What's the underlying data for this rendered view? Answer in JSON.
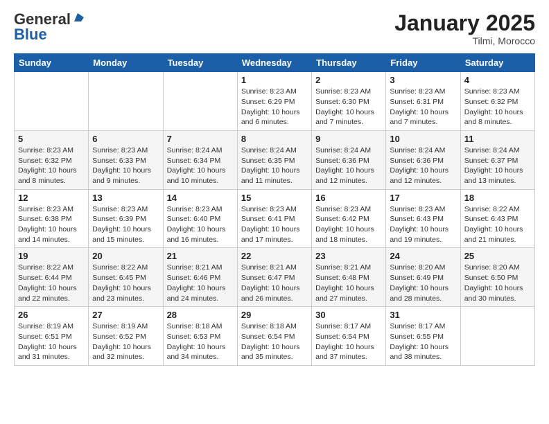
{
  "logo": {
    "general": "General",
    "blue": "Blue"
  },
  "header": {
    "month": "January 2025",
    "location": "Tilmi, Morocco"
  },
  "weekdays": [
    "Sunday",
    "Monday",
    "Tuesday",
    "Wednesday",
    "Thursday",
    "Friday",
    "Saturday"
  ],
  "weeks": [
    [
      {
        "day": "",
        "info": ""
      },
      {
        "day": "",
        "info": ""
      },
      {
        "day": "",
        "info": ""
      },
      {
        "day": "1",
        "info": "Sunrise: 8:23 AM\nSunset: 6:29 PM\nDaylight: 10 hours\nand 6 minutes."
      },
      {
        "day": "2",
        "info": "Sunrise: 8:23 AM\nSunset: 6:30 PM\nDaylight: 10 hours\nand 7 minutes."
      },
      {
        "day": "3",
        "info": "Sunrise: 8:23 AM\nSunset: 6:31 PM\nDaylight: 10 hours\nand 7 minutes."
      },
      {
        "day": "4",
        "info": "Sunrise: 8:23 AM\nSunset: 6:32 PM\nDaylight: 10 hours\nand 8 minutes."
      }
    ],
    [
      {
        "day": "5",
        "info": "Sunrise: 8:23 AM\nSunset: 6:32 PM\nDaylight: 10 hours\nand 8 minutes."
      },
      {
        "day": "6",
        "info": "Sunrise: 8:23 AM\nSunset: 6:33 PM\nDaylight: 10 hours\nand 9 minutes."
      },
      {
        "day": "7",
        "info": "Sunrise: 8:24 AM\nSunset: 6:34 PM\nDaylight: 10 hours\nand 10 minutes."
      },
      {
        "day": "8",
        "info": "Sunrise: 8:24 AM\nSunset: 6:35 PM\nDaylight: 10 hours\nand 11 minutes."
      },
      {
        "day": "9",
        "info": "Sunrise: 8:24 AM\nSunset: 6:36 PM\nDaylight: 10 hours\nand 12 minutes."
      },
      {
        "day": "10",
        "info": "Sunrise: 8:24 AM\nSunset: 6:36 PM\nDaylight: 10 hours\nand 12 minutes."
      },
      {
        "day": "11",
        "info": "Sunrise: 8:24 AM\nSunset: 6:37 PM\nDaylight: 10 hours\nand 13 minutes."
      }
    ],
    [
      {
        "day": "12",
        "info": "Sunrise: 8:23 AM\nSunset: 6:38 PM\nDaylight: 10 hours\nand 14 minutes."
      },
      {
        "day": "13",
        "info": "Sunrise: 8:23 AM\nSunset: 6:39 PM\nDaylight: 10 hours\nand 15 minutes."
      },
      {
        "day": "14",
        "info": "Sunrise: 8:23 AM\nSunset: 6:40 PM\nDaylight: 10 hours\nand 16 minutes."
      },
      {
        "day": "15",
        "info": "Sunrise: 8:23 AM\nSunset: 6:41 PM\nDaylight: 10 hours\nand 17 minutes."
      },
      {
        "day": "16",
        "info": "Sunrise: 8:23 AM\nSunset: 6:42 PM\nDaylight: 10 hours\nand 18 minutes."
      },
      {
        "day": "17",
        "info": "Sunrise: 8:23 AM\nSunset: 6:43 PM\nDaylight: 10 hours\nand 19 minutes."
      },
      {
        "day": "18",
        "info": "Sunrise: 8:22 AM\nSunset: 6:43 PM\nDaylight: 10 hours\nand 21 minutes."
      }
    ],
    [
      {
        "day": "19",
        "info": "Sunrise: 8:22 AM\nSunset: 6:44 PM\nDaylight: 10 hours\nand 22 minutes."
      },
      {
        "day": "20",
        "info": "Sunrise: 8:22 AM\nSunset: 6:45 PM\nDaylight: 10 hours\nand 23 minutes."
      },
      {
        "day": "21",
        "info": "Sunrise: 8:21 AM\nSunset: 6:46 PM\nDaylight: 10 hours\nand 24 minutes."
      },
      {
        "day": "22",
        "info": "Sunrise: 8:21 AM\nSunset: 6:47 PM\nDaylight: 10 hours\nand 26 minutes."
      },
      {
        "day": "23",
        "info": "Sunrise: 8:21 AM\nSunset: 6:48 PM\nDaylight: 10 hours\nand 27 minutes."
      },
      {
        "day": "24",
        "info": "Sunrise: 8:20 AM\nSunset: 6:49 PM\nDaylight: 10 hours\nand 28 minutes."
      },
      {
        "day": "25",
        "info": "Sunrise: 8:20 AM\nSunset: 6:50 PM\nDaylight: 10 hours\nand 30 minutes."
      }
    ],
    [
      {
        "day": "26",
        "info": "Sunrise: 8:19 AM\nSunset: 6:51 PM\nDaylight: 10 hours\nand 31 minutes."
      },
      {
        "day": "27",
        "info": "Sunrise: 8:19 AM\nSunset: 6:52 PM\nDaylight: 10 hours\nand 32 minutes."
      },
      {
        "day": "28",
        "info": "Sunrise: 8:18 AM\nSunset: 6:53 PM\nDaylight: 10 hours\nand 34 minutes."
      },
      {
        "day": "29",
        "info": "Sunrise: 8:18 AM\nSunset: 6:54 PM\nDaylight: 10 hours\nand 35 minutes."
      },
      {
        "day": "30",
        "info": "Sunrise: 8:17 AM\nSunset: 6:54 PM\nDaylight: 10 hours\nand 37 minutes."
      },
      {
        "day": "31",
        "info": "Sunrise: 8:17 AM\nSunset: 6:55 PM\nDaylight: 10 hours\nand 38 minutes."
      },
      {
        "day": "",
        "info": ""
      }
    ]
  ]
}
